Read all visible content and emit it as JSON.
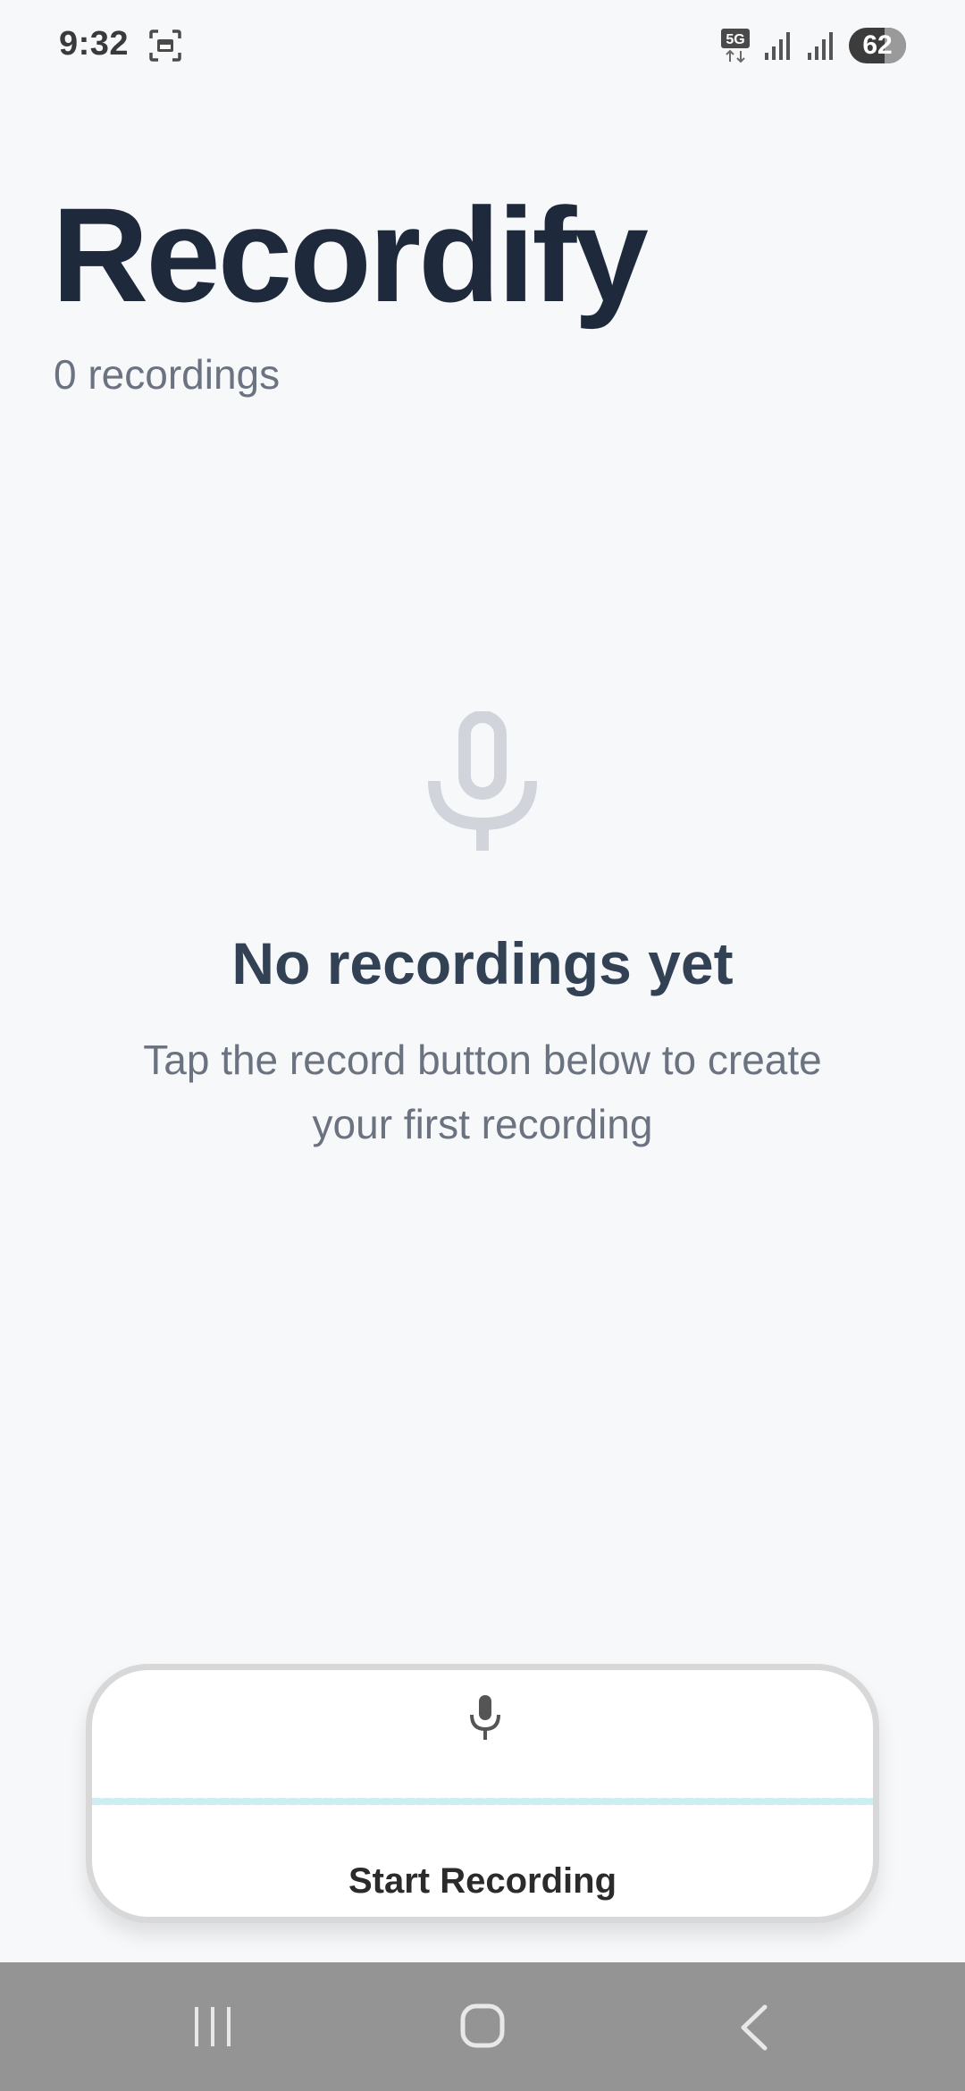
{
  "status_bar": {
    "time": "9:32",
    "network": "5G",
    "battery_level": "62",
    "icons": [
      "screenshot-icon",
      "5g-icon",
      "signal-icon",
      "signal-icon",
      "battery-icon"
    ]
  },
  "header": {
    "title": "Recordify",
    "recordings_count": "0 recordings"
  },
  "empty_state": {
    "icon": "microphone-icon",
    "title": "No recordings yet",
    "subtitle": "Tap the record button below to create your first recording"
  },
  "record_card": {
    "icon": "microphone-icon",
    "button_label": "Start Recording"
  },
  "nav_bar": {
    "items": [
      "recents-icon",
      "home-icon",
      "back-icon"
    ]
  },
  "colors": {
    "background": "#f7f8fa",
    "title_text": "#1e293b",
    "muted_text": "#6b7280",
    "waveform": "#cdeef0",
    "nav_bar": "#949494"
  }
}
